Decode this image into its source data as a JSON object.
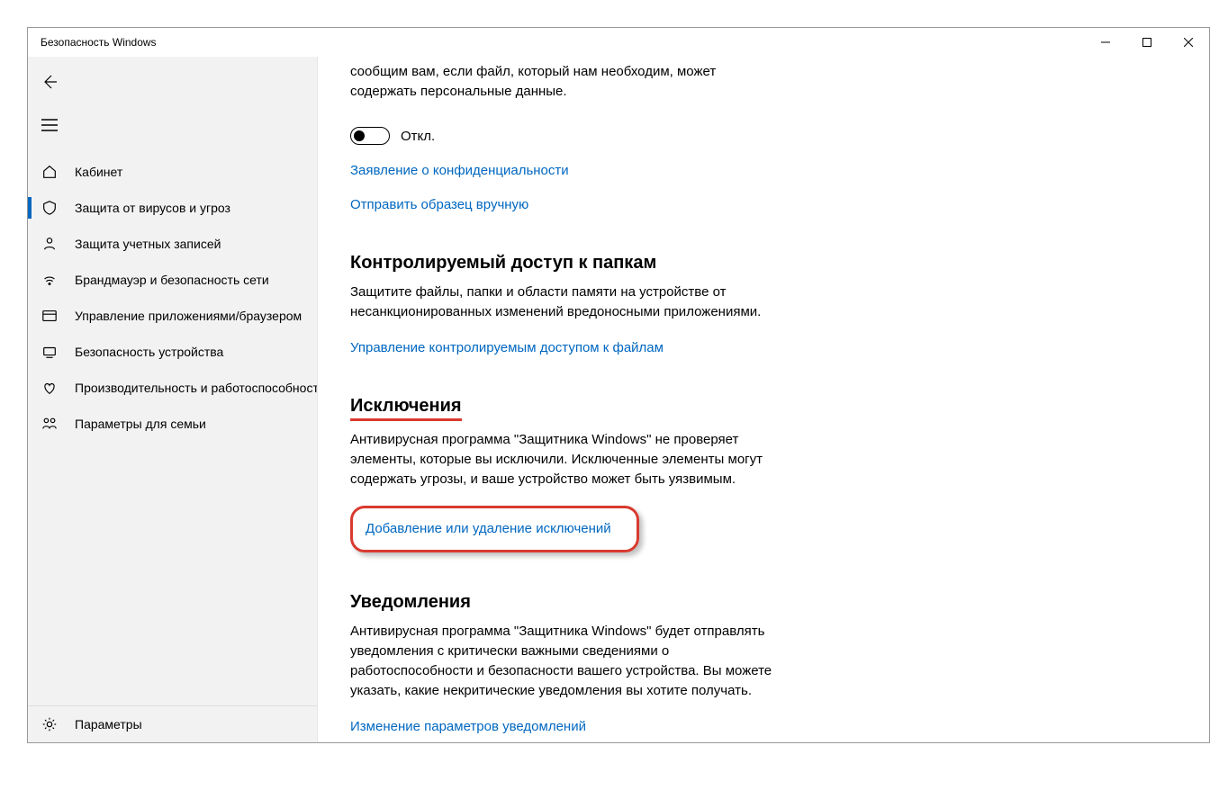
{
  "window_title": "Безопасность Windows",
  "sidebar": {
    "items": [
      {
        "label": "Кабинет"
      },
      {
        "label": "Защита от вирусов и угроз"
      },
      {
        "label": "Защита учетных записей"
      },
      {
        "label": "Брандмауэр и безопасность сети"
      },
      {
        "label": "Управление приложениями/браузером"
      },
      {
        "label": "Безопасность устройства"
      },
      {
        "label": "Производительность и работоспособность устройства"
      },
      {
        "label": "Параметры для семьи"
      }
    ],
    "settings_label": "Параметры"
  },
  "content": {
    "truncated_top": "сообщим вам, если файл, который нам необходим, может содержать персональные данные.",
    "toggle_label": "Откл.",
    "privacy_link": "Заявление о конфиденциальности",
    "submit_sample_link": "Отправить образец вручную",
    "section_folder": {
      "title": "Контролируемый доступ к папкам",
      "desc": "Защитите файлы, папки и области памяти на устройстве от несанкционированных изменений вредоносными приложениями.",
      "link": "Управление контролируемым доступом к файлам"
    },
    "section_exclusions": {
      "title": "Исключения",
      "desc": "Антивирусная программа \"Защитника Windows\" не проверяет элементы, которые вы исключили. Исключенные элементы могут содержать угрозы, и ваше устройство может быть уязвимым.",
      "link": "Добавление или удаление исключений"
    },
    "section_notifications": {
      "title": "Уведомления",
      "desc": "Антивирусная программа \"Защитника Windows\" будет отправлять уведомления с критически важными сведениями о работоспособности и безопасности вашего устройства. Вы можете указать, какие некритические уведомления вы хотите получать.",
      "link": "Изменение параметров уведомлений"
    }
  }
}
